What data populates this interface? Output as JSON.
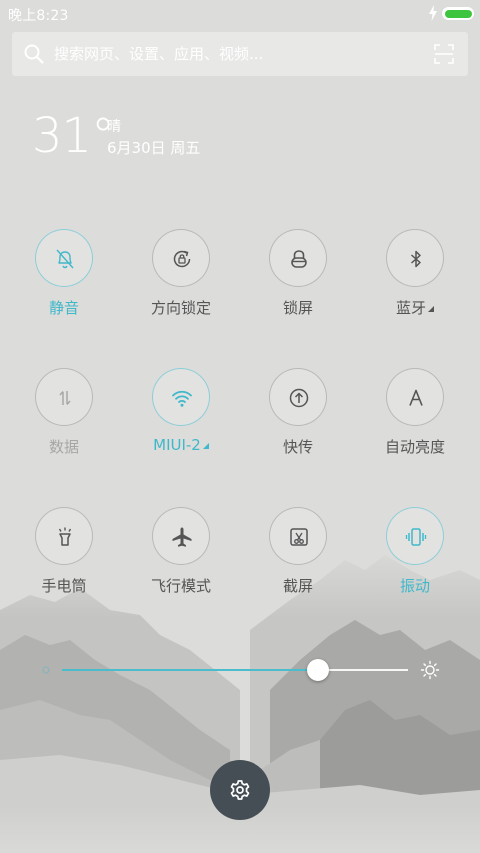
{
  "status_bar": {
    "time": "晚上8:23",
    "battery_level": 1.0,
    "charging": true
  },
  "search": {
    "placeholder": "搜索网页、设置、应用、视频..."
  },
  "weather": {
    "temperature": "31°",
    "condition": "晴",
    "date": "6月30日 周五"
  },
  "toggles": [
    {
      "label": "静音",
      "icon": "bell-off-icon",
      "state": "active"
    },
    {
      "label": "方向锁定",
      "icon": "rotation-lock-icon",
      "state": "off"
    },
    {
      "label": "锁屏",
      "icon": "lock-icon",
      "state": "off"
    },
    {
      "label": "蓝牙",
      "icon": "bluetooth-icon",
      "state": "off",
      "has_more": true
    },
    {
      "label": "数据",
      "icon": "data-arrows-icon",
      "state": "disabled"
    },
    {
      "label": "MIUI-2",
      "icon": "wifi-icon",
      "state": "active",
      "has_more": true
    },
    {
      "label": "快传",
      "icon": "upload-icon",
      "state": "off"
    },
    {
      "label": "自动亮度",
      "icon": "auto-brightness-icon",
      "state": "off"
    },
    {
      "label": "手电筒",
      "icon": "flashlight-icon",
      "state": "off"
    },
    {
      "label": "飞行模式",
      "icon": "airplane-icon",
      "state": "off"
    },
    {
      "label": "截屏",
      "icon": "screenshot-icon",
      "state": "off"
    },
    {
      "label": "振动",
      "icon": "vibrate-icon",
      "state": "active"
    }
  ],
  "brightness": {
    "level": 0.74
  },
  "colors": {
    "accent": "#3fb8c9",
    "battery": "#3fc43f",
    "settings_button": "#464e55",
    "label": "#555555",
    "background": "#dcdcdb"
  }
}
